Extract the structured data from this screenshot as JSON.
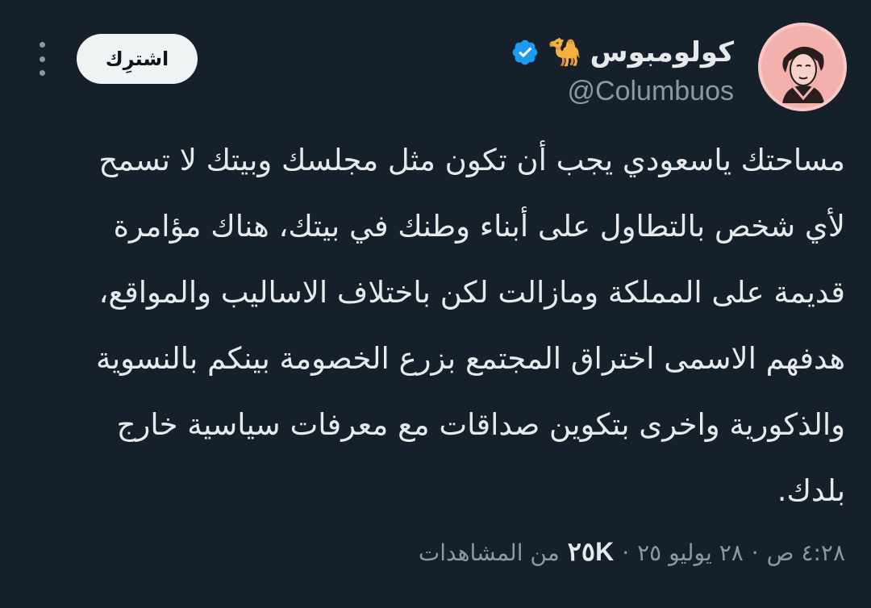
{
  "author": {
    "display_name": "كولومبوس",
    "name_emoji": "🐪",
    "handle": "@Columbuos",
    "verified_color": "#1d9bf0",
    "avatar_bg": "#f3b0ad"
  },
  "actions": {
    "subscribe_label": "اشترِك",
    "more_icon": "more-vertical-icon"
  },
  "tweet": {
    "text": "مساحتك ياسعودي يجب أن تكون مثل مجلسك وبيتك لا تسمح\nلأي شخص بالتطاول على أبناء وطنك في بيتك، هناك مؤامرة\nقديمة على المملكة ومازالت لكن باختلاف الاساليب والمواقع،\nهدفهم الاسمى اختراق المجتمع بزرع الخصومة بينكم بالنسوية\nوالذكورية واخرى بتكوين صداقات مع معرفات سياسية خارج\nبلدك."
  },
  "meta": {
    "time": "٤:٢٨ ص",
    "date": "٢٨ يوليو ٢٥",
    "separator": "·",
    "views_count": "٢٥K",
    "views_label": "من المشاهدات"
  }
}
